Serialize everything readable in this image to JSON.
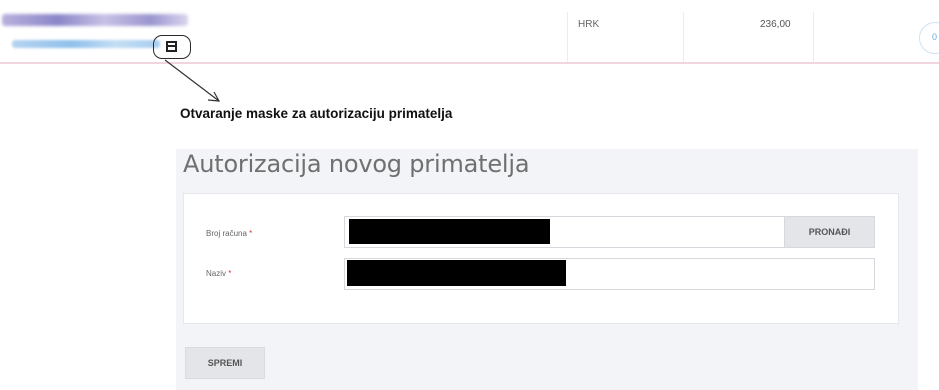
{
  "payment_row": {
    "currency": "HRK",
    "amount": "236,00",
    "action_badge": "0"
  },
  "annotation": {
    "text": "Otvaranje maske za autorizaciju primatelja"
  },
  "form": {
    "title": "Autorizacija novog primatelja",
    "account_label": "Broj računa",
    "name_label": "Naziv",
    "required_mark": "*",
    "find_button": "PRONAĐI",
    "save_button": "SPREMI"
  }
}
